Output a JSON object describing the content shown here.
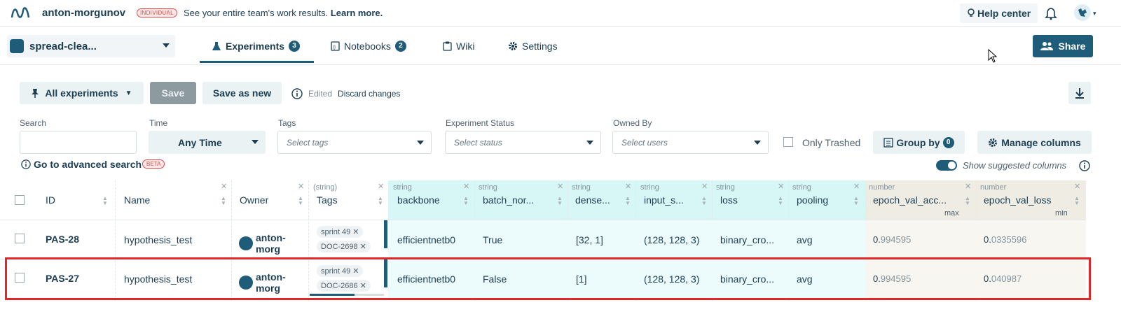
{
  "top": {
    "username": "anton-morgunov",
    "plan_badge": "INDIVIDUAL",
    "promo_text": "See your entire team's work results.",
    "promo_link": "Learn more.",
    "help_center": "Help center"
  },
  "project": {
    "name": "spread-clea...",
    "tabs": [
      {
        "label": "Experiments",
        "count": "3"
      },
      {
        "label": "Notebooks",
        "count": "2"
      },
      {
        "label": "Wiki"
      },
      {
        "label": "Settings"
      }
    ],
    "share_label": "Share"
  },
  "toolbar": {
    "view_label": "All experiments",
    "save_label": "Save",
    "save_as_new_label": "Save as new",
    "edited_label": "Edited",
    "discard_label": "Discard changes"
  },
  "filters": {
    "search_label": "Search",
    "time_label": "Time",
    "time_value": "Any Time",
    "tags_label": "Tags",
    "tags_placeholder": "Select tags",
    "status_label": "Experiment Status",
    "status_placeholder": "Select status",
    "owner_label": "Owned By",
    "owner_placeholder": "Select users",
    "only_trashed": "Only Trashed",
    "group_by": "Group by",
    "group_by_count": "0",
    "manage_columns": "Manage columns",
    "advanced_search": "Go to advanced search",
    "beta_badge": "BETA",
    "show_suggested": "Show suggested columns"
  },
  "table": {
    "columns": [
      {
        "name": "ID",
        "type": ""
      },
      {
        "name": "Name",
        "type": ""
      },
      {
        "name": "Owner",
        "type": ""
      },
      {
        "name": "Tags",
        "type": "(string)"
      },
      {
        "name": "backbone",
        "type": "string"
      },
      {
        "name": "batch_nor...",
        "type": "string"
      },
      {
        "name": "dense...",
        "type": "string"
      },
      {
        "name": "input_s...",
        "type": "string"
      },
      {
        "name": "loss",
        "type": "string"
      },
      {
        "name": "pooling",
        "type": "string"
      },
      {
        "name": "epoch_val_acc...",
        "type": "number",
        "agg": "max"
      },
      {
        "name": "epoch_val_loss",
        "type": "number",
        "agg": "min"
      }
    ],
    "rows": [
      {
        "id": "PAS-28",
        "name": "hypothesis_test",
        "owner": "anton-morg",
        "tags": [
          "sprint 49",
          "DOC-2698"
        ],
        "backbone": "efficientnetb0",
        "batch_norm": "True",
        "dense": "[32, 1]",
        "input_shape": "(128, 128, 3)",
        "loss": "binary_cro...",
        "pooling": "avg",
        "acc_int": "0.",
        "acc_frac": "994595",
        "loss_int": "0.",
        "loss_frac": "0335596"
      },
      {
        "id": "PAS-27",
        "name": "hypothesis_test",
        "owner": "anton-morg",
        "tags": [
          "sprint 49",
          "DOC-2686"
        ],
        "backbone": "efficientnetb0",
        "batch_norm": "False",
        "dense": "[1]",
        "input_shape": "(128, 128, 3)",
        "loss": "binary_cro...",
        "pooling": "avg",
        "acc_int": "0.",
        "acc_frac": "994595",
        "loss_int": "0.",
        "loss_frac": "040987"
      }
    ]
  },
  "colors": {
    "accent": "#1e5c7a",
    "highlight": "#e0282a",
    "teal_header": "#d7f6f6"
  }
}
